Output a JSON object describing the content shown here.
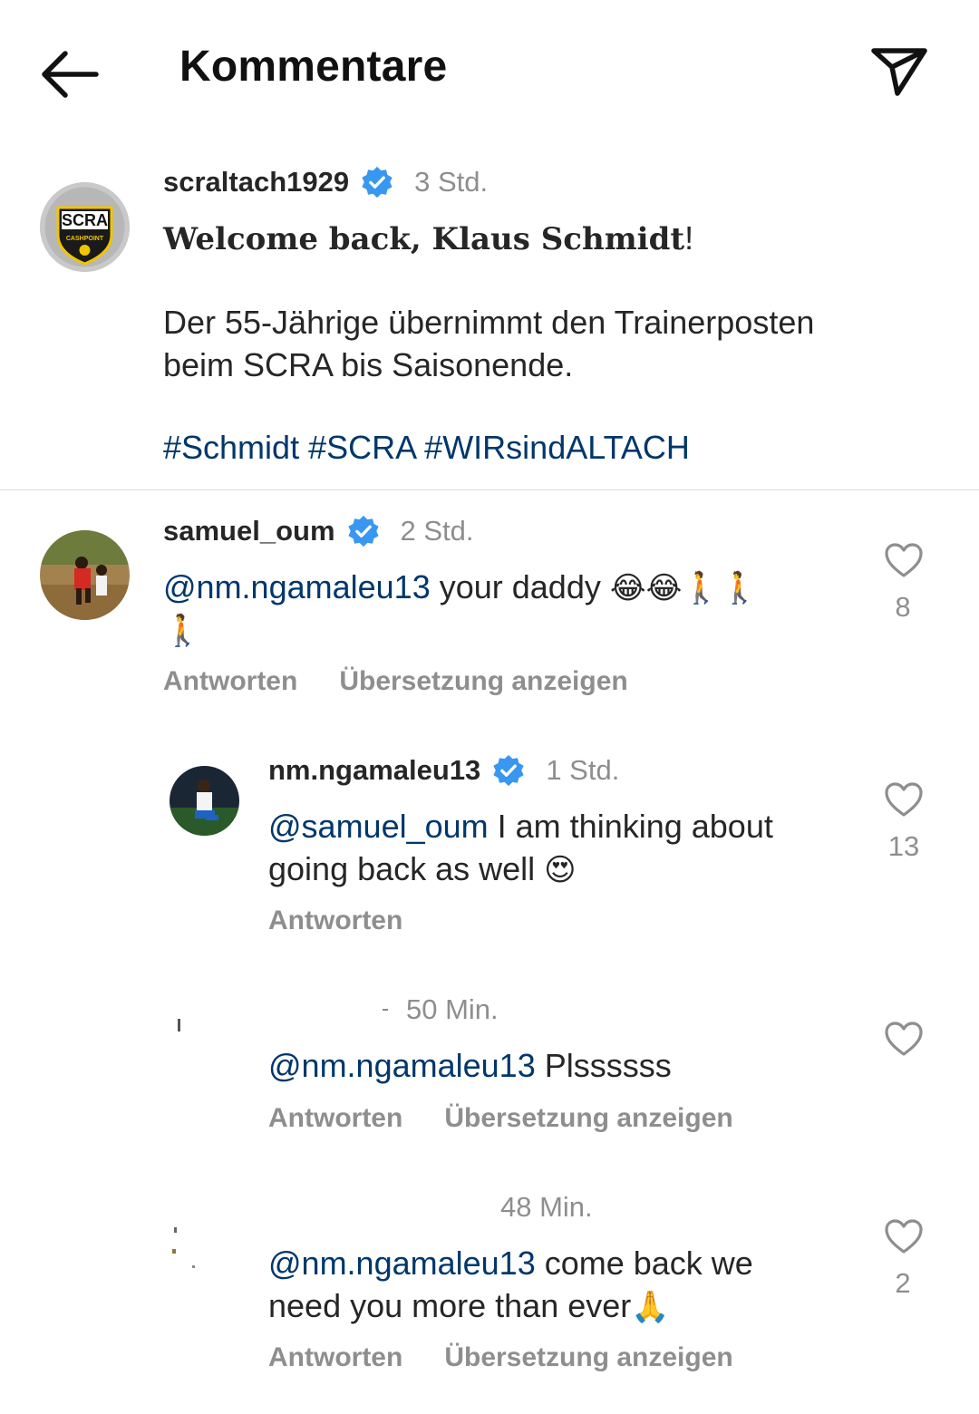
{
  "header": {
    "title": "Kommentare"
  },
  "caption": {
    "username": "scraltach1929",
    "time": "3 Std.",
    "title_text": "Welcome back, Klaus Schmidt",
    "title_punct": "!",
    "text_line1": "Der 55-Jährige übernimmt den Trainerposten",
    "text_line2": "beim SCRA bis Saisonende.",
    "hashtags": [
      "#Schmidt",
      "#SCRA",
      "#WIRsindALTACH"
    ],
    "logo_text": "SCRA",
    "logo_sub": "CASHPOINT"
  },
  "comments": [
    {
      "username": "samuel_oum",
      "time": "2 Std.",
      "mention": "@nm.ngamaleu13",
      "text": " your daddy ",
      "emojis_line1": "😂😂🚶🚶",
      "emojis_line2": "🚶",
      "likes": "8",
      "reply_label": "Antworten",
      "translate_label": "Übersetzung anzeigen"
    },
    {
      "username": "nm.ngamaleu13",
      "time": "1 Std.",
      "mention": "@samuel_oum",
      "text_line1": " I am thinking about",
      "text_line2": "going back as well ",
      "emoji": "😍",
      "likes": "13",
      "reply_label": "Antworten"
    },
    {
      "username": "",
      "time": "50 Min.",
      "mention": "@nm.ngamaleu13",
      "text": " Plssssss",
      "likes": "",
      "reply_label": "Antworten",
      "translate_label": "Übersetzung anzeigen"
    },
    {
      "username": "",
      "time": "48 Min.",
      "mention": "@nm.ngamaleu13",
      "text_line1": " come back we",
      "text_line2": "need you more than ever",
      "emoji": "🙏",
      "likes": "2",
      "reply_label": "Antworten",
      "translate_label": "Übersetzung anzeigen"
    }
  ],
  "colors": {
    "link": "#00376b",
    "muted": "#8e8e8e",
    "verified": "#3897f0",
    "text": "#262626"
  },
  "icons": [
    "back-arrow-icon",
    "send-icon",
    "verified-badge-icon",
    "heart-icon"
  ]
}
